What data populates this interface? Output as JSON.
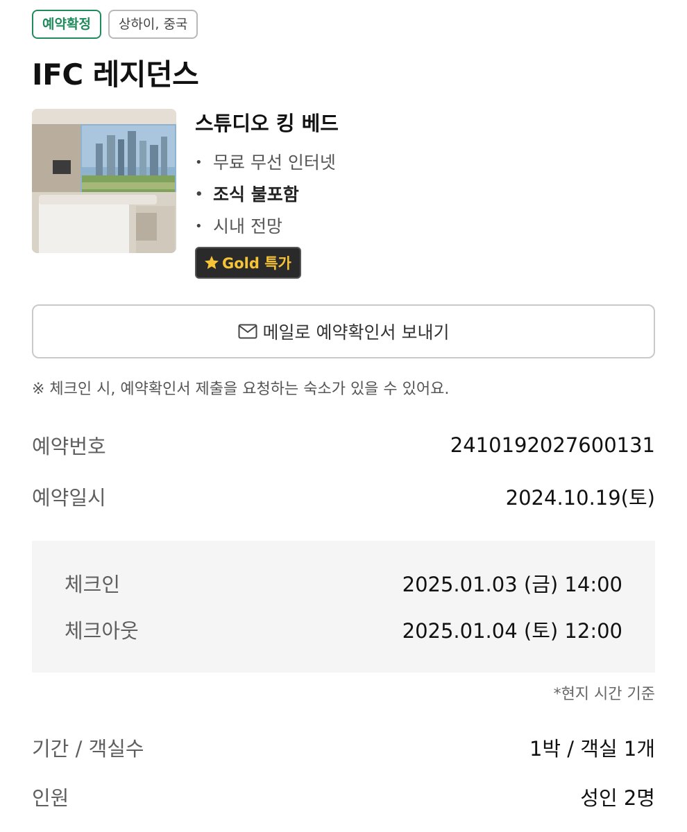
{
  "tags": {
    "status": "예약확정",
    "location": "상하이, 중국"
  },
  "hotel": {
    "name": "IFC 레지던스"
  },
  "room": {
    "name": "스튜디오 킹 베드",
    "features": [
      {
        "text": "무료 무선 인터넷",
        "bold": false
      },
      {
        "text": "조식 불포함",
        "bold": true
      },
      {
        "text": "시내 전망",
        "bold": false
      }
    ],
    "badge": {
      "label": "Gold 특가",
      "icon": "star-icon",
      "color": "#f7c437"
    }
  },
  "actions": {
    "email_button": "메일로 예약확인서 보내기",
    "email_icon": "mail-icon"
  },
  "notice": "※ 체크인 시, 예약확인서 제출을 요청하는 숙소가 있을 수 있어요.",
  "booking": {
    "number_label": "예약번호",
    "number": "2410192027600131",
    "date_label": "예약일시",
    "date": "2024.10.19(토)"
  },
  "stay": {
    "checkin_label": "체크인",
    "checkin": "2025.01.03 (금) 14:00",
    "checkout_label": "체크아웃",
    "checkout": "2025.01.04 (토) 12:00",
    "local_note": "*현지 시간 기준"
  },
  "details": {
    "period_label": "기간 / 객실수",
    "period": "1박 / 객실 1개",
    "guests_label": "인원",
    "guests": "성인 2명"
  },
  "colors": {
    "status_green": "#1f8a5a",
    "gold": "#f7c437",
    "panel_bg": "#f5f5f5"
  }
}
